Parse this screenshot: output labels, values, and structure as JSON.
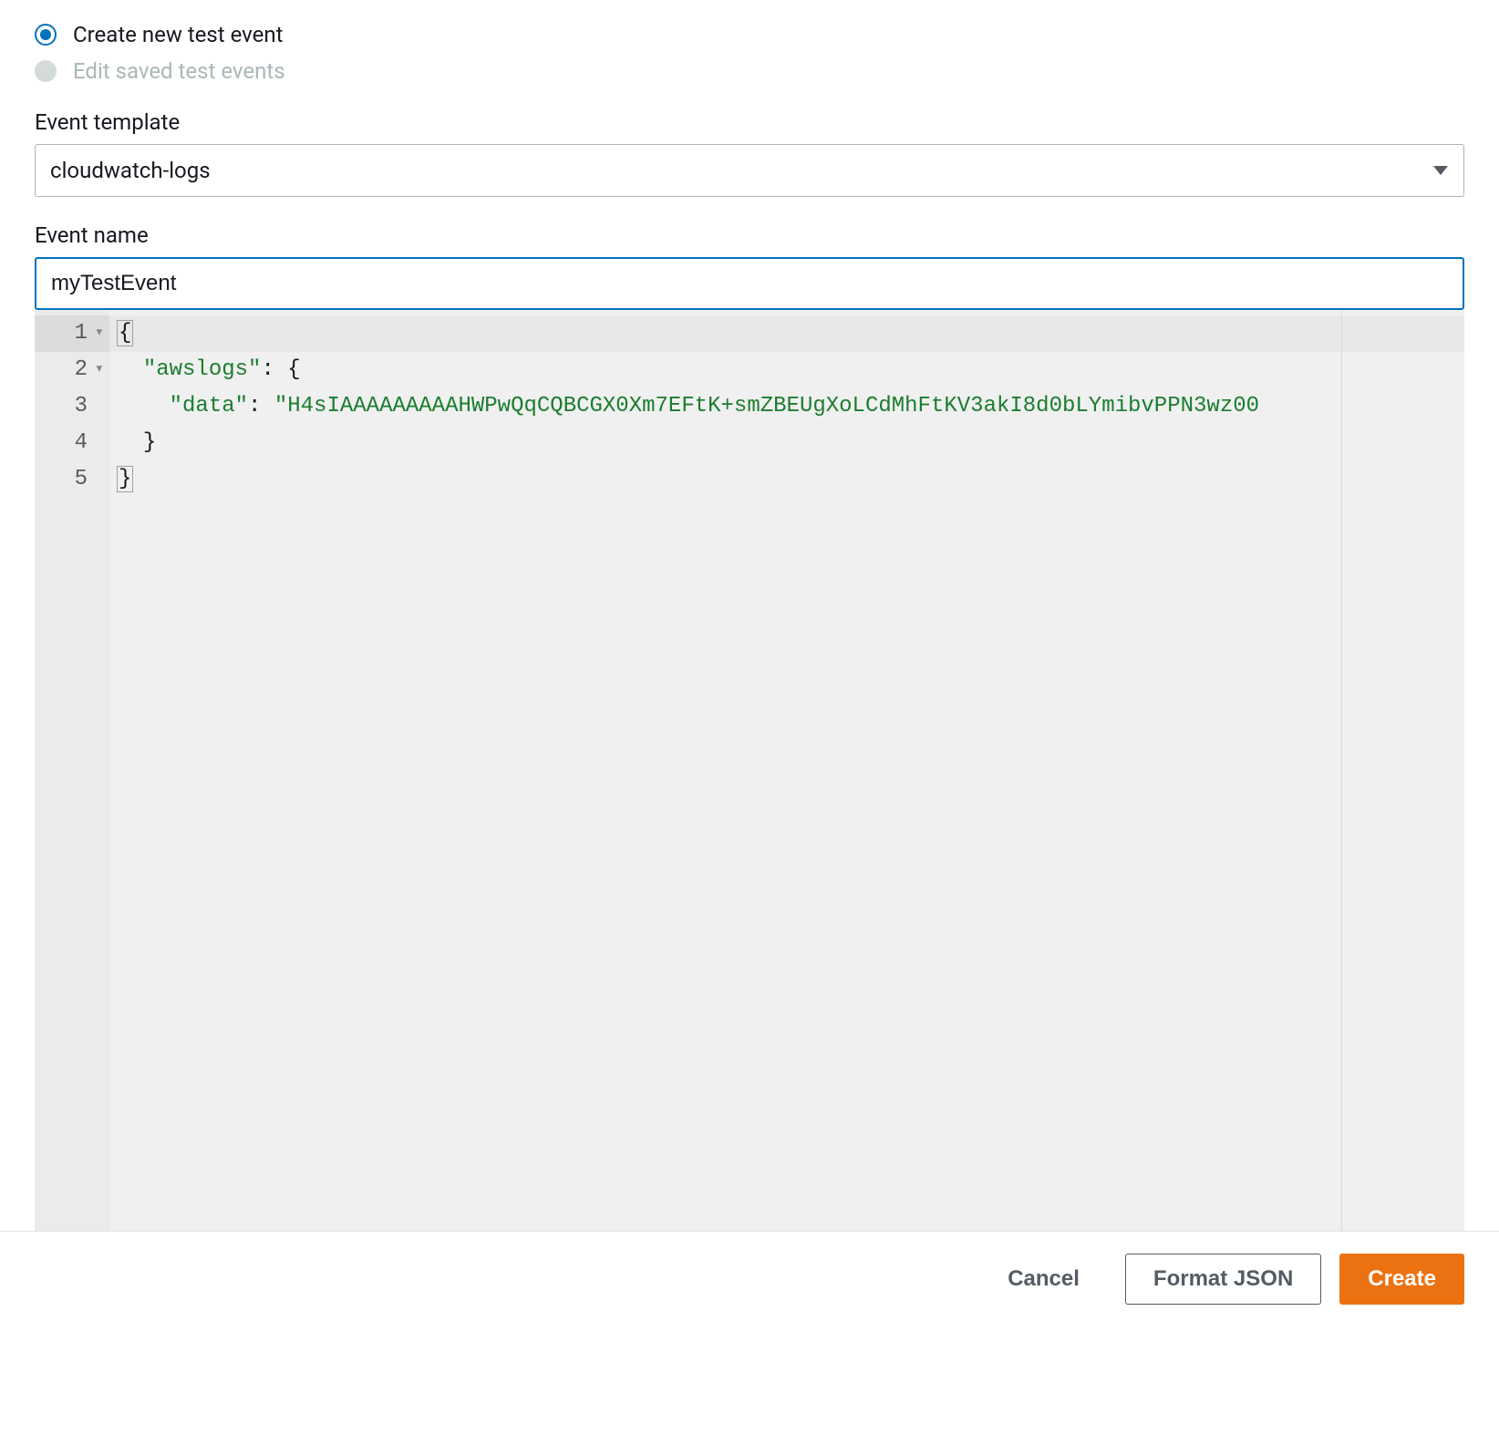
{
  "radios": {
    "create_new": {
      "label": "Create new test event",
      "selected": true,
      "disabled": false
    },
    "edit_saved": {
      "label": "Edit saved test events",
      "selected": false,
      "disabled": true
    }
  },
  "form": {
    "template_label": "Event template",
    "template_value": "cloudwatch-logs",
    "name_label": "Event name",
    "name_value": "myTestEvent"
  },
  "code": {
    "lines": [
      "1",
      "2",
      "3",
      "4",
      "5"
    ],
    "tokens": {
      "l1_open": "{",
      "l2_key": "\"awslogs\"",
      "l2_colon": ": ",
      "l2_open": "{",
      "l3_key": "\"data\"",
      "l3_colon": ": ",
      "l3_value": "\"H4sIAAAAAAAAAHWPwQqCQBCGX0Xm7EFtK+smZBEUgXoLCdMhFtKV3akI8d0bLYmibvPPN3wz00",
      "l4_close": "}",
      "l5_close": "}"
    }
  },
  "footer": {
    "cancel": "Cancel",
    "format": "Format JSON",
    "create": "Create"
  }
}
